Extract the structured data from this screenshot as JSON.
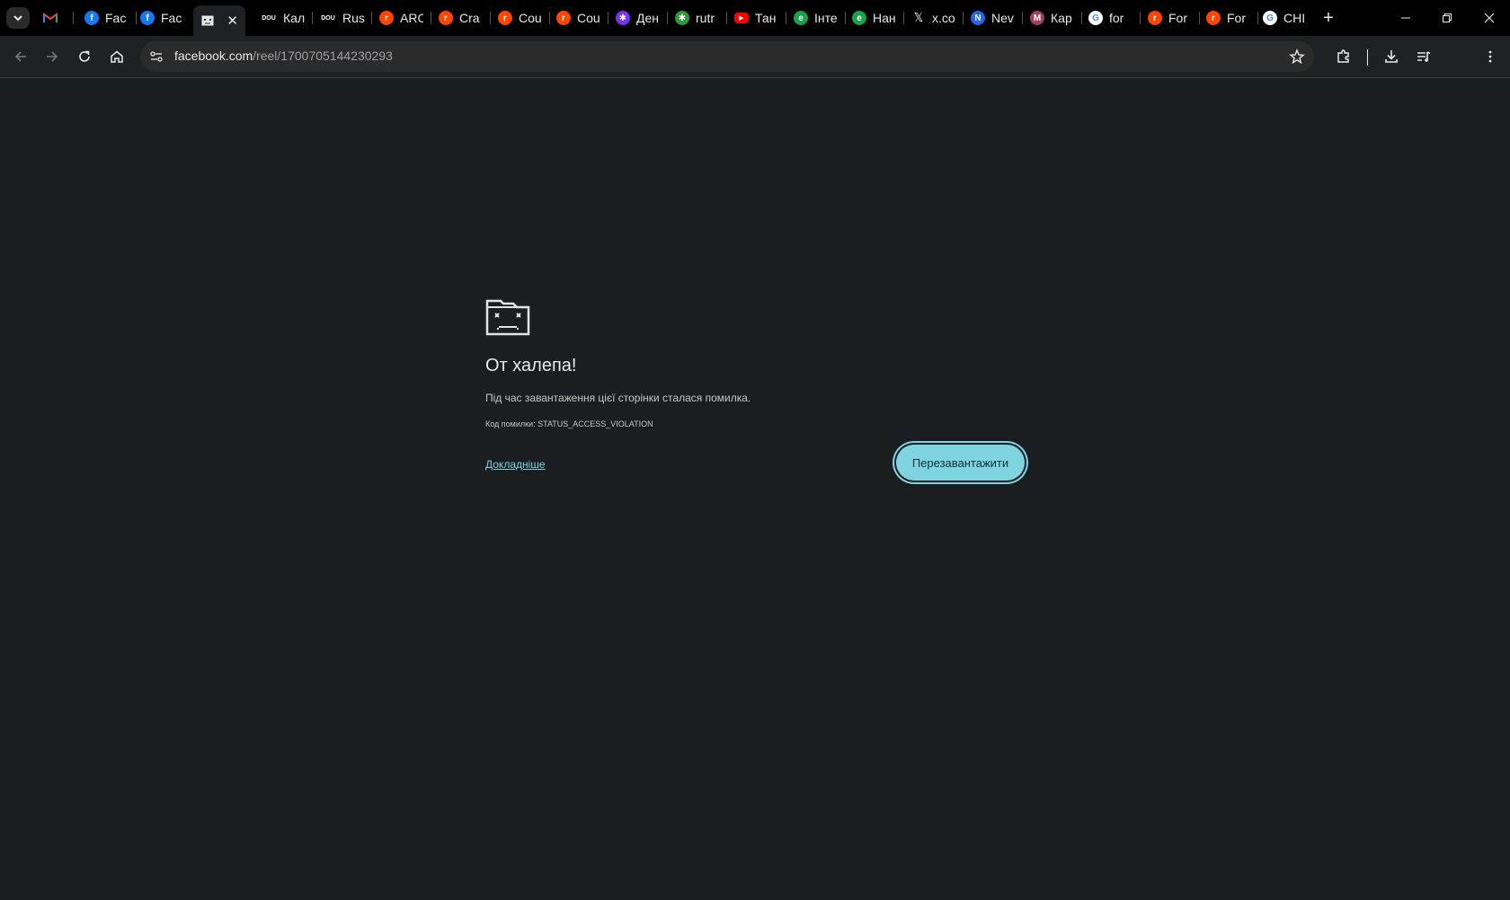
{
  "browser": {
    "tabs": [
      {
        "label": "",
        "icon": "gmail-icon",
        "color": "#ea4335",
        "glyph": "M"
      },
      {
        "label": "Fac",
        "icon": "facebook-icon",
        "color": "#1877f2",
        "glyph": "f"
      },
      {
        "label": "Fac",
        "icon": "facebook-icon",
        "color": "#1877f2",
        "glyph": "f"
      },
      {
        "label": "",
        "icon": "crashed-page-icon",
        "color": "#e8e8e8",
        "glyph": "",
        "active": true
      },
      {
        "label": "Кал",
        "icon": "dou-icon",
        "color": "#000000",
        "glyph": "DOU"
      },
      {
        "label": "Rus",
        "icon": "dou-icon",
        "color": "#000000",
        "glyph": "DOU"
      },
      {
        "label": "ARC",
        "icon": "reddit-icon",
        "color": "#ff4500",
        "glyph": "r"
      },
      {
        "label": "Cra",
        "icon": "reddit-icon",
        "color": "#ff4500",
        "glyph": "r"
      },
      {
        "label": "Cou",
        "icon": "reddit-icon",
        "color": "#ff4500",
        "glyph": "r"
      },
      {
        "label": "Cou",
        "icon": "reddit-icon",
        "color": "#ff4500",
        "glyph": "r"
      },
      {
        "label": "Ден",
        "icon": "news-icon",
        "color": "#7b2ff7",
        "glyph": "✱"
      },
      {
        "label": "rutr",
        "icon": "news-icon",
        "color": "#2e9a3e",
        "glyph": "✱"
      },
      {
        "label": "Тан",
        "icon": "youtube-icon",
        "color": "#ff0000",
        "glyph": "▶"
      },
      {
        "label": "Інте",
        "icon": "green-circle-icon",
        "color": "#1aa34a",
        "glyph": "e"
      },
      {
        "label": "Нан",
        "icon": "green-circle-icon",
        "color": "#1aa34a",
        "glyph": "e"
      },
      {
        "label": "x.co",
        "icon": "x-icon",
        "color": "#000000",
        "glyph": "X"
      },
      {
        "label": "Nev",
        "icon": "document-icon",
        "color": "#2563eb",
        "glyph": "N"
      },
      {
        "label": "Кар",
        "icon": "map-icon",
        "color": "#a04060",
        "glyph": "M"
      },
      {
        "label": "for",
        "icon": "google-icon",
        "color": "#ffffff",
        "glyph": "G"
      },
      {
        "label": "For",
        "icon": "reddit-icon",
        "color": "#ff4500",
        "glyph": "r"
      },
      {
        "label": "For",
        "icon": "reddit-icon",
        "color": "#ff4500",
        "glyph": "r"
      },
      {
        "label": "CHI",
        "icon": "google-icon",
        "color": "#ffffff",
        "glyph": "G"
      }
    ],
    "address": {
      "host": "facebook.com",
      "path": "/reel/1700705144230293"
    }
  },
  "error": {
    "title": "От халепа!",
    "message": "Під час завантаження цієї сторінки сталася помилка.",
    "code": "Код помилки: STATUS_ACCESS_VIOLATION",
    "learn_more": "Докладніше",
    "reload": "Перезавантажити"
  },
  "colors": {
    "accent": "#7fd4e2",
    "link": "#7fd1e0",
    "background": "#1a1e21"
  }
}
